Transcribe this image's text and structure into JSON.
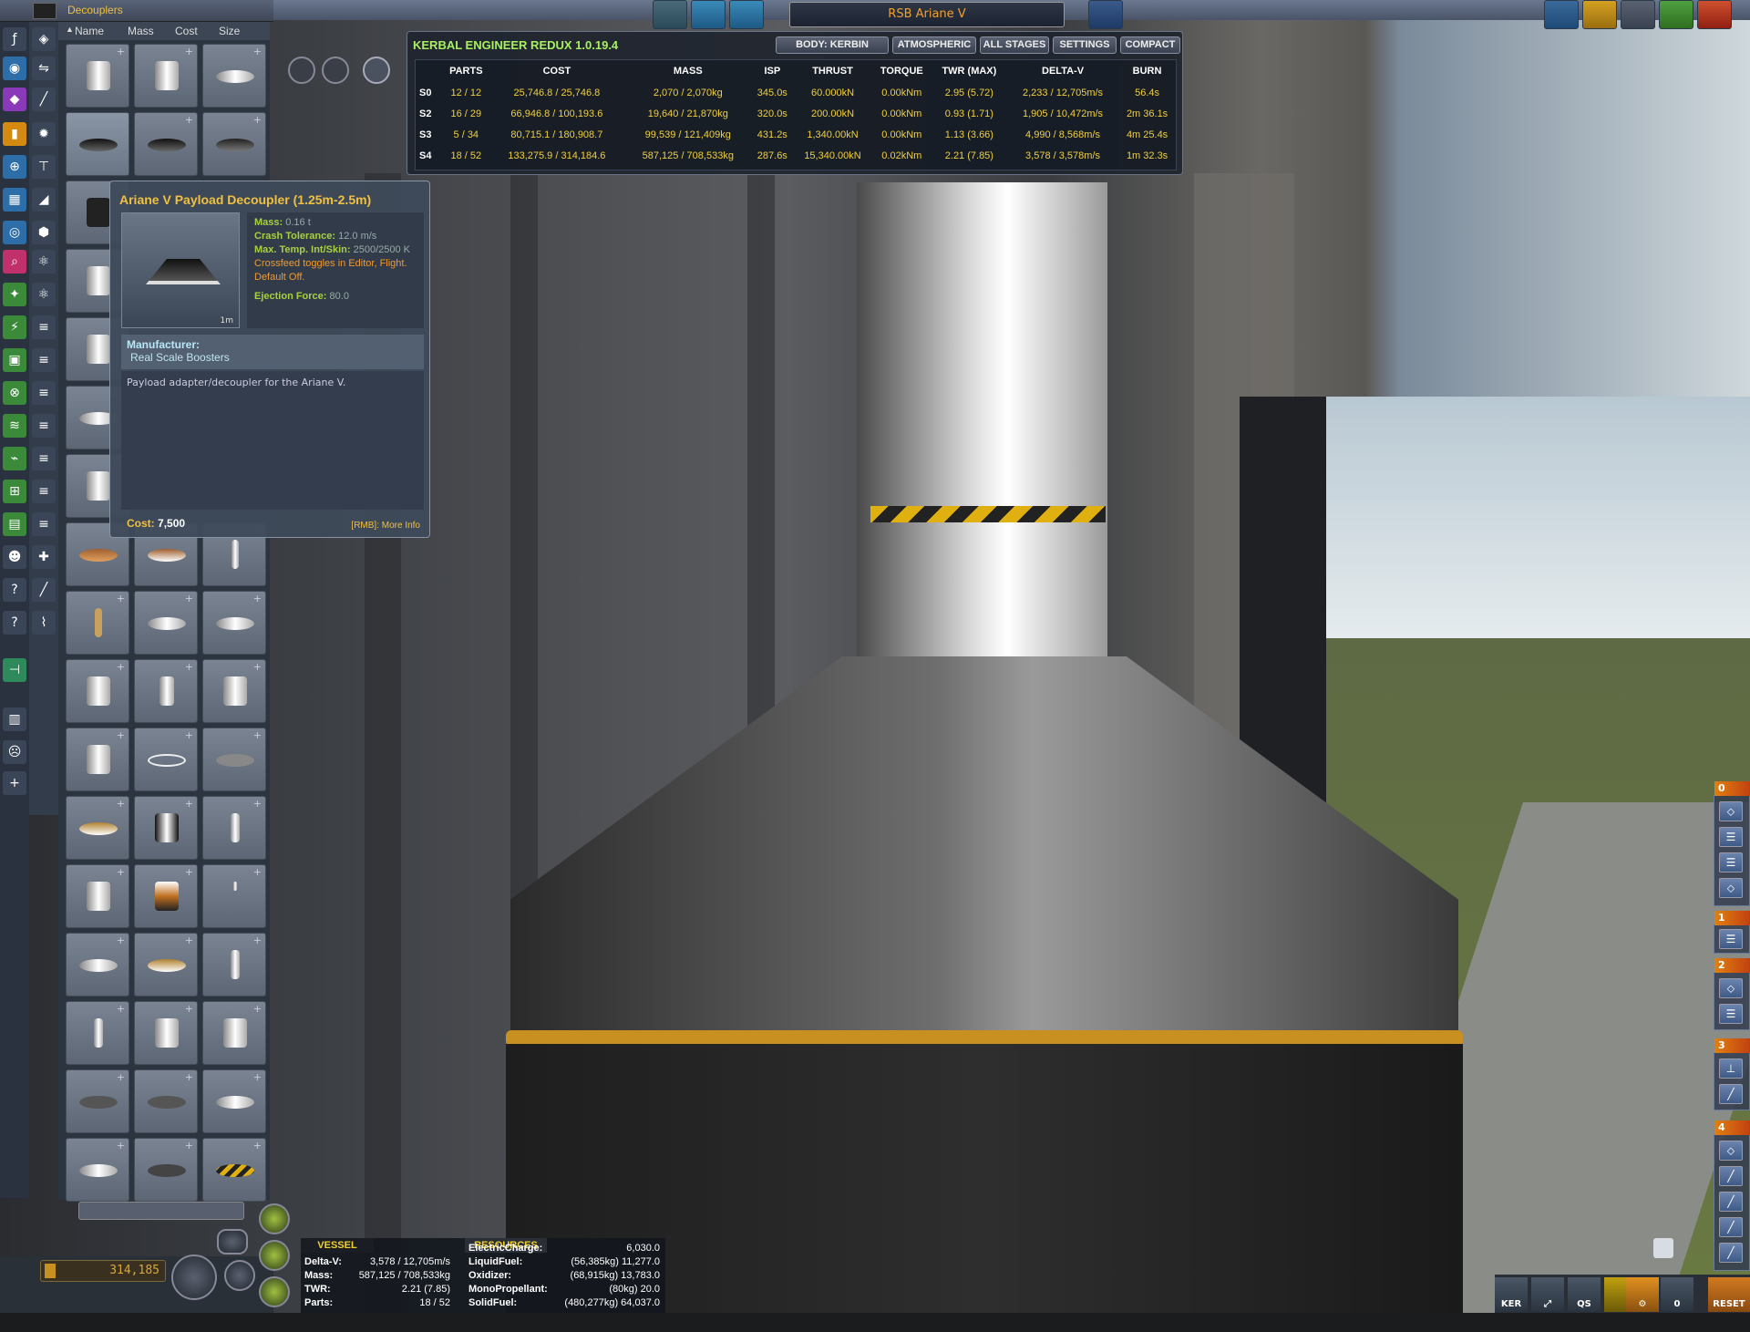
{
  "window": {
    "category_title": "Decouplers",
    "ship_name": "RSB Ariane V"
  },
  "sort": {
    "name": "Name",
    "mass": "Mass",
    "cost": "Cost",
    "size": "Size"
  },
  "ker": {
    "title": "KERBAL ENGINEER REDUX 1.0.19.4",
    "buttons": [
      "BODY: KERBIN",
      "ATMOSPHERIC",
      "ALL STAGES",
      "SETTINGS",
      "COMPACT"
    ],
    "headers": [
      "PARTS",
      "COST",
      "MASS",
      "ISP",
      "THRUST",
      "TORQUE",
      "TWR (MAX)",
      "DELTA-V",
      "BURN"
    ],
    "rows": [
      {
        "stage": "S0",
        "parts": "12 / 12",
        "cost": "25,746.8 / 25,746.8",
        "mass": "2,070 / 2,070kg",
        "isp": "345.0s",
        "thrust": "60.000kN",
        "torque": "0.00kNm",
        "twr": "2.95 (5.72)",
        "dv": "2,233 / 12,705m/s",
        "burn": "56.4s"
      },
      {
        "stage": "S2",
        "parts": "16 / 29",
        "cost": "66,946.8 / 100,193.6",
        "mass": "19,640 / 21,870kg",
        "isp": "320.0s",
        "thrust": "200.00kN",
        "torque": "0.00kNm",
        "twr": "0.93 (1.71)",
        "dv": "1,905 / 10,472m/s",
        "burn": "2m 36.1s"
      },
      {
        "stage": "S3",
        "parts": "5 / 34",
        "cost": "80,715.1 / 180,908.7",
        "mass": "99,539 / 121,409kg",
        "isp": "431.2s",
        "thrust": "1,340.00kN",
        "torque": "0.00kNm",
        "twr": "1.13 (3.66)",
        "dv": "4,990 / 8,568m/s",
        "burn": "4m 25.4s"
      },
      {
        "stage": "S4",
        "parts": "18 / 52",
        "cost": "133,275.9 / 314,184.6",
        "mass": "587,125 / 708,533kg",
        "isp": "287.6s",
        "thrust": "15,340.00kN",
        "torque": "0.02kNm",
        "twr": "2.21 (7.85)",
        "dv": "3,578 / 3,578m/s",
        "burn": "1m 32.3s"
      }
    ]
  },
  "tooltip": {
    "title": "Ariane V Payload Decoupler (1.25m-2.5m)",
    "scale_label": "1m",
    "stats": [
      {
        "key": "Mass:",
        "value": "0.16 t"
      },
      {
        "key": "Crash Tolerance:",
        "value": "12.0 m/s"
      },
      {
        "key": "Max. Temp. Int/Skin:",
        "value": "2500/2500 K"
      }
    ],
    "crossfeed_line1": "Crossfeed toggles in Editor, Flight.",
    "crossfeed_line2": "Default Off.",
    "ejection_key": "Ejection Force:",
    "ejection_value": "80.0",
    "manufacturer_label": "Manufacturer:",
    "manufacturer": "Real Scale Boosters",
    "description": "Payload adapter/decoupler for the Ariane V.",
    "cost_label": "Cost:",
    "cost_value": "7,500",
    "more_info": "[RMB]: More Info"
  },
  "funds": "314,185",
  "vessel": {
    "tab": "VESSEL",
    "rows": [
      {
        "label": "Delta-V:",
        "value": "3,578 / 12,705m/s"
      },
      {
        "label": "Mass:",
        "value": "587,125 / 708,533kg"
      },
      {
        "label": "TWR:",
        "value": "2.21 (7.85)"
      },
      {
        "label": "Parts:",
        "value": "18 / 52"
      }
    ]
  },
  "resources": {
    "tab": "RESOURCES",
    "rows": [
      {
        "label": "ElectricCharge:",
        "value": "6,030.0"
      },
      {
        "label": "LiquidFuel:",
        "value": "(56,385kg) 11,277.0"
      },
      {
        "label": "Oxidizer:",
        "value": "(68,915kg) 13,783.0"
      },
      {
        "label": "MonoPropellant:",
        "value": "(80kg) 20.0"
      },
      {
        "label": "SolidFuel:",
        "value": "(480,277kg) 64,037.0"
      }
    ]
  },
  "staging": {
    "stages": [
      "0",
      "1",
      "2",
      "3",
      "4"
    ]
  },
  "bottom_right": {
    "ker_label": "KER",
    "qs_label": "QS",
    "comm_count": "0",
    "reset_label": "RESET"
  },
  "colors": {
    "accent_yellow": "#f0c040",
    "ker_green": "#a8f060",
    "value_yellow": "#f0d040",
    "stage_orange": "#e08010"
  }
}
